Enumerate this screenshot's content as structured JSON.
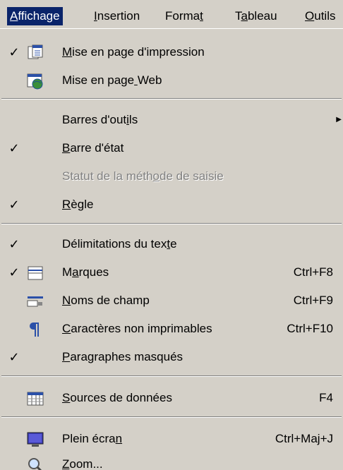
{
  "menubar": {
    "items": [
      {
        "label": "Affichage",
        "mnemonic_index": 0
      },
      {
        "label": "Insertion",
        "mnemonic_index": 0
      },
      {
        "label": "Format",
        "mnemonic_index": 5
      },
      {
        "label": "Tableau",
        "mnemonic_index": 1
      },
      {
        "label": "Outils",
        "mnemonic_index": 0
      }
    ]
  },
  "menu": {
    "items": [
      {
        "label": "Mise en page d'impression",
        "mnemonic_index": 0,
        "checked": true,
        "icon": "print-layout-icon"
      },
      {
        "label": "Mise en page Web",
        "mnemonic_index": 12,
        "checked": false,
        "icon": "web-layout-icon"
      },
      {
        "label": "Barres d'outils",
        "mnemonic_index": 12,
        "checked": false,
        "submenu": true
      },
      {
        "label": "Barre d'état",
        "mnemonic_index": 0,
        "checked": true
      },
      {
        "label": "Statut de la méthode de saisie",
        "mnemonic_index": 17,
        "checked": false,
        "disabled": true
      },
      {
        "label": "Règle",
        "mnemonic_index": 0,
        "checked": true
      },
      {
        "label": "Délimitations du texte",
        "mnemonic_index": 20,
        "checked": true
      },
      {
        "label": "Marques",
        "mnemonic_index": 1,
        "checked": true,
        "icon": "bookmarks-icon",
        "shortcut": "Ctrl+F8"
      },
      {
        "label": "Noms de champ",
        "mnemonic_index": 0,
        "checked": false,
        "icon": "field-names-icon",
        "shortcut": "Ctrl+F9"
      },
      {
        "label": "Caractères non imprimables",
        "mnemonic_index": 0,
        "checked": false,
        "icon": "pilcrow-icon",
        "shortcut": "Ctrl+F10"
      },
      {
        "label": "Paragraphes masqués",
        "mnemonic_index": 0,
        "checked": true
      },
      {
        "label": "Sources de données",
        "mnemonic_index": 0,
        "checked": false,
        "icon": "data-sources-icon",
        "shortcut": "F4"
      },
      {
        "label": "Plein écran",
        "mnemonic_index": 10,
        "checked": false,
        "icon": "full-screen-icon",
        "shortcut": "Ctrl+Maj+J"
      },
      {
        "label": "Zoom...",
        "mnemonic_index": 0,
        "checked": false,
        "icon": "zoom-icon"
      }
    ]
  },
  "colors": {
    "menu_bg": "#d4d0c8",
    "highlight": "#0a246a",
    "disabled_text": "#808080"
  }
}
